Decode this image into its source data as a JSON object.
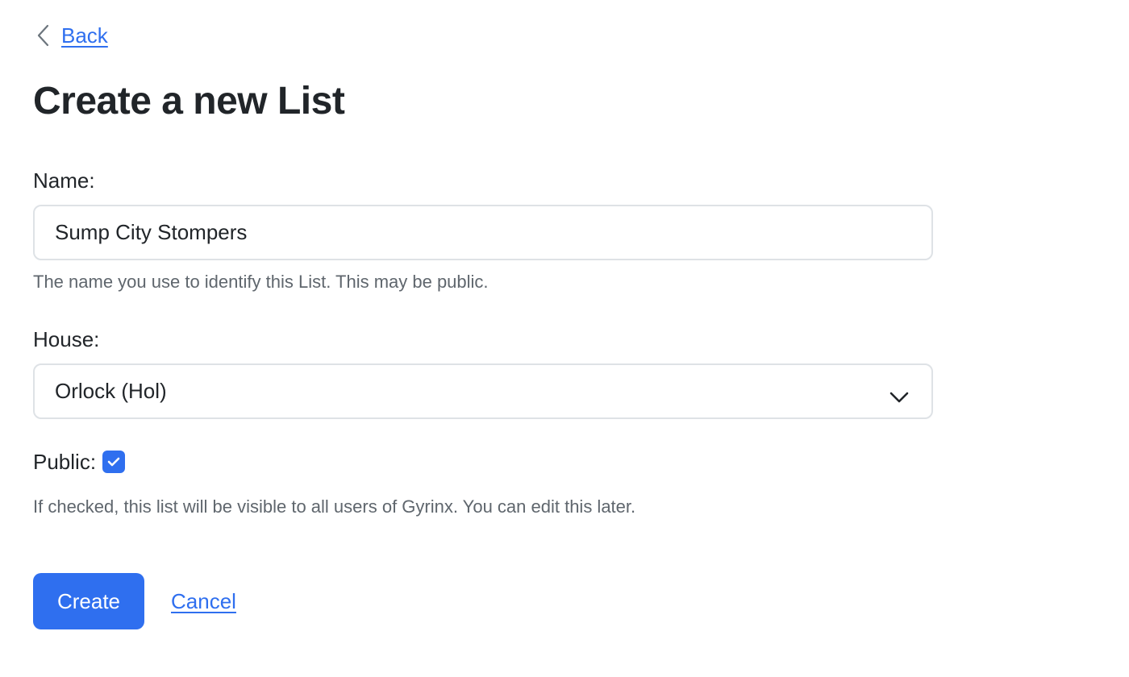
{
  "nav": {
    "back_label": "Back",
    "back_icon": "chevron-left-icon"
  },
  "page": {
    "title": "Create a new List"
  },
  "form": {
    "name": {
      "label": "Name:",
      "value": "Sump City Stompers",
      "help": "The name you use to identify this List. This may be public."
    },
    "house": {
      "label": "House:",
      "selected": "Orlock (Hol)",
      "icon": "chevron-down-icon"
    },
    "public": {
      "label": "Public:",
      "checked": true,
      "help": "If checked, this list will be visible to all users of Gyrinx. You can edit this later."
    },
    "actions": {
      "create_label": "Create",
      "cancel_label": "Cancel"
    }
  },
  "colors": {
    "accent": "#2f6fef",
    "text": "#212529",
    "muted": "#5f666d",
    "border": "#dee2e6"
  }
}
